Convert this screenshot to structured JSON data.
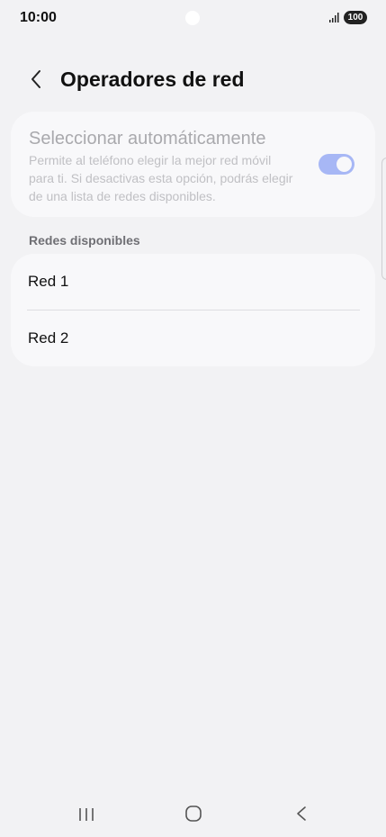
{
  "status_bar": {
    "time": "10:00",
    "battery": "100",
    "icons": [
      "camera-dot",
      "signal-icon",
      "battery-badge"
    ]
  },
  "header": {
    "title": "Operadores de red",
    "back_icon": "chevron-left-icon"
  },
  "auto_select": {
    "title": "Seleccionar automáticamente",
    "description": "Permite al teléfono elegir la mejor red móvil para ti. Si desactivas esta opción, podrás elegir de una lista de redes disponibles.",
    "enabled": true,
    "disabled_state": true
  },
  "networks": {
    "section_label": "Redes disponibles",
    "items": [
      {
        "label": "Red 1"
      },
      {
        "label": "Red 2"
      }
    ]
  },
  "nav_bar": {
    "icons": [
      "recents-icon",
      "home-icon",
      "back-icon"
    ]
  },
  "colors": {
    "background": "#f2f2f4",
    "card": "#f8f8fa",
    "toggle_track": "#a7b7f5",
    "text_primary": "#111111",
    "text_disabled": "#a9a9ad"
  }
}
